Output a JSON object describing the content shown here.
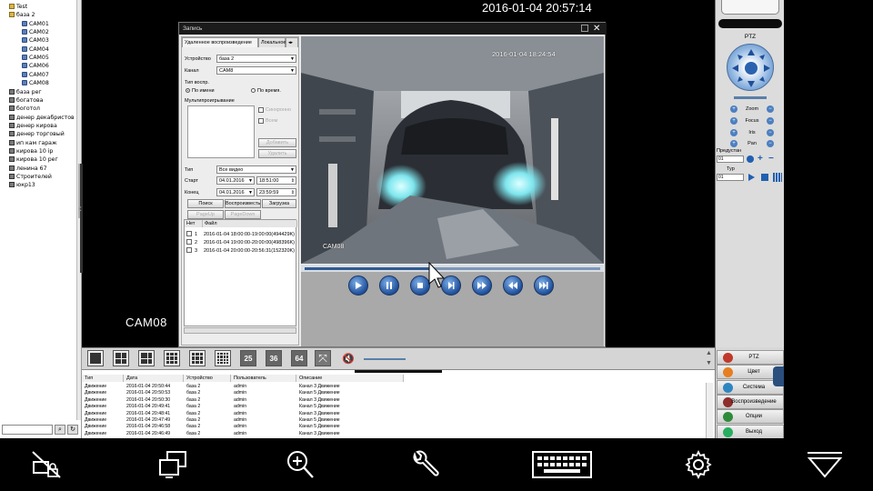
{
  "tree": {
    "items": [
      {
        "label": "Test",
        "depth": 1,
        "type": "folder"
      },
      {
        "label": "база 2",
        "depth": 1,
        "type": "folder"
      },
      {
        "label": "CAM01",
        "depth": 2,
        "type": "cam"
      },
      {
        "label": "CAM02",
        "depth": 2,
        "type": "cam"
      },
      {
        "label": "CAM03",
        "depth": 2,
        "type": "cam"
      },
      {
        "label": "CAM04",
        "depth": 2,
        "type": "cam"
      },
      {
        "label": "CAM05",
        "depth": 2,
        "type": "cam"
      },
      {
        "label": "CAM06",
        "depth": 2,
        "type": "cam"
      },
      {
        "label": "CAM07",
        "depth": 2,
        "type": "cam"
      },
      {
        "label": "CAM08",
        "depth": 2,
        "type": "cam"
      },
      {
        "label": "база рег",
        "depth": 1,
        "type": "dev"
      },
      {
        "label": "богатова",
        "depth": 1,
        "type": "dev"
      },
      {
        "label": "боготол",
        "depth": 1,
        "type": "dev"
      },
      {
        "label": "денер декабристов",
        "depth": 1,
        "type": "dev"
      },
      {
        "label": "денер кирова",
        "depth": 1,
        "type": "dev"
      },
      {
        "label": "денер торговый",
        "depth": 1,
        "type": "dev"
      },
      {
        "label": "ип кам гараж",
        "depth": 1,
        "type": "dev"
      },
      {
        "label": "кирова 10 ip",
        "depth": 1,
        "type": "dev"
      },
      {
        "label": "кирова 10 рег",
        "depth": 1,
        "type": "dev"
      },
      {
        "label": "ленина 67",
        "depth": 1,
        "type": "dev"
      },
      {
        "label": "Строителей",
        "depth": 1,
        "type": "dev"
      },
      {
        "label": "юкр13",
        "depth": 1,
        "type": "dev"
      }
    ]
  },
  "main": {
    "timestamp": "2016-01-04 20:57:14",
    "camera_label": "CAM08"
  },
  "playback": {
    "title": "Запись",
    "tabs": [
      "Удаленное воспроизведение",
      "Локальное"
    ],
    "device_label": "Устройство",
    "device_value": "база 2",
    "channel_label": "Канал",
    "channel_value": "CAM8",
    "mode_label": "Тип воспр.",
    "mode_by_name": "По имени",
    "mode_by_time": "По время.",
    "multiplay_label": "Мультипроигрывание",
    "cb_sync": "Синхронно",
    "cb_all": "Всем",
    "add_btn": "Добавить",
    "del_btn": "Удалить",
    "type_label": "Тип",
    "type_value": "Все видео",
    "start_label": "Старт",
    "start_date": "04.01.2016",
    "start_time": "18:51:00",
    "end_label": "Конец",
    "end_date": "04.01.2016",
    "end_time": "23:59:59",
    "search_btn": "Поиск",
    "play_btn": "Воспроизвесть",
    "download_btn": "Загрузка",
    "pageup_btn": "PageUp",
    "pagedown_btn": "PageDown",
    "col_no": "Нет",
    "col_file": "Файл",
    "files": [
      {
        "no": "1",
        "name": "2016-01-04 18:00:00-19:00:00(494429K)"
      },
      {
        "no": "2",
        "name": "2016-01-04 19:00:00-20:00:00(498396K)"
      },
      {
        "no": "3",
        "name": "2016-01-04 20:00:00-20:56:31(152320K)"
      }
    ],
    "video_timestamp": "2016-01-04 18:24:54",
    "video_camera": "CAM08",
    "progress": 0.43
  },
  "ptz": {
    "title": "PTZ",
    "zoom": "Zoom",
    "focus": "Focus",
    "iris": "Iris",
    "pan": "Pan",
    "preset_label": "Предустан",
    "preset_value": "01",
    "tour_label": "Тур",
    "tour_value": "01"
  },
  "toolbar": {
    "layouts": [
      "1",
      "4",
      "8",
      "9",
      "10",
      "13",
      "16",
      "20",
      "25",
      "36",
      "64"
    ]
  },
  "log": {
    "columns": [
      "Тип",
      "Дата",
      "Устройство",
      "Пользователь",
      "Описание"
    ],
    "rows": [
      [
        "Движение",
        "2016-01-04 20:50:44",
        "база 2",
        "admin",
        "Канал 3 Движение"
      ],
      [
        "Движение",
        "2016-01-04 20:50:53",
        "база 2",
        "admin",
        "Канал 5 Движение"
      ],
      [
        "Движение",
        "2016-01-04 20:50:30",
        "база 2",
        "admin",
        "Канал 3 Движение"
      ],
      [
        "Движение",
        "2016-01-04 20:49:41",
        "база 2",
        "admin",
        "Канал 5 Движение"
      ],
      [
        "Движение",
        "2016-01-04 20:48:41",
        "база 2",
        "admin",
        "Канал 3 Движение"
      ],
      [
        "Движение",
        "2016-01-04 20:47:49",
        "база 2",
        "admin",
        "Канал 5 Движение"
      ],
      [
        "Движение",
        "2016-01-04 20:46:58",
        "база 2",
        "admin",
        "Канал 5 Движение"
      ],
      [
        "Движение",
        "2016-01-04 20:46:49",
        "база 2",
        "admin",
        "Канал 3 Движение"
      ]
    ]
  },
  "menu": {
    "items": [
      {
        "label": "PTZ",
        "color": "#c0392b"
      },
      {
        "label": "Цвет",
        "color": "#e67e22"
      },
      {
        "label": "Система",
        "color": "#2e86c1"
      },
      {
        "label": "Воспроизведение",
        "color": "#8e2c2c"
      },
      {
        "label": "Опции",
        "color": "#2e8b3a"
      },
      {
        "label": "Выход",
        "color": "#27ae60"
      }
    ]
  },
  "colors": {
    "accent": "#2f5a92",
    "ptz_blue": "#4d7fc0"
  }
}
